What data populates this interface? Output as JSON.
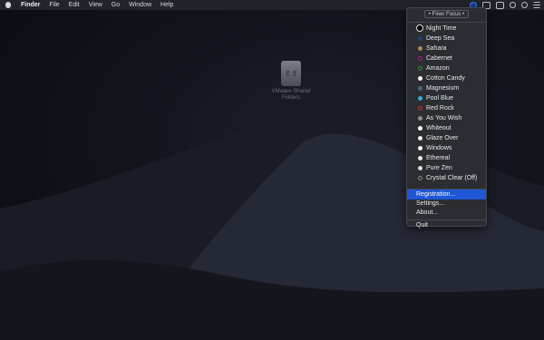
{
  "menubar": {
    "app_name": "Finder",
    "menus": [
      "File",
      "Edit",
      "View",
      "Go",
      "Window",
      "Help"
    ]
  },
  "desktop": {
    "drive_label": "VMware Shared Folders"
  },
  "dropdown": {
    "header": "• Finer Focus •",
    "themes": [
      {
        "label": "Night Time",
        "color": "#000000"
      },
      {
        "label": "Deep Sea",
        "color": "#1d3e6e"
      },
      {
        "label": "Sahara",
        "color": "#b08a55"
      },
      {
        "label": "Cabernet",
        "color": "#9c2a8c"
      },
      {
        "label": "Amazon",
        "color": "#2f8f3a"
      },
      {
        "label": "Cotton Candy",
        "color": "#f2f2f2"
      },
      {
        "label": "Magnesium",
        "color": "#3f6a7a"
      },
      {
        "label": "Pool Blue",
        "color": "#3aa7d6"
      },
      {
        "label": "Red Rock",
        "color": "#c0392b"
      },
      {
        "label": "As You Wish",
        "color": "#8a8a8a"
      },
      {
        "label": "Whiteout",
        "color": "#ffffff"
      },
      {
        "label": "Glaze Over",
        "color": "#f0f0f0"
      },
      {
        "label": "Windows",
        "color": "#f5f5f5"
      },
      {
        "label": "Ethereal",
        "color": "#eaeaea"
      },
      {
        "label": "Pure Zen",
        "color": "#dcdcdc"
      },
      {
        "label": "Crystal Clear (Off)",
        "color": "#8a8a8a"
      }
    ],
    "registration": "Registration...",
    "settings": "Settings...",
    "about": "About...",
    "quit": "Quit"
  }
}
